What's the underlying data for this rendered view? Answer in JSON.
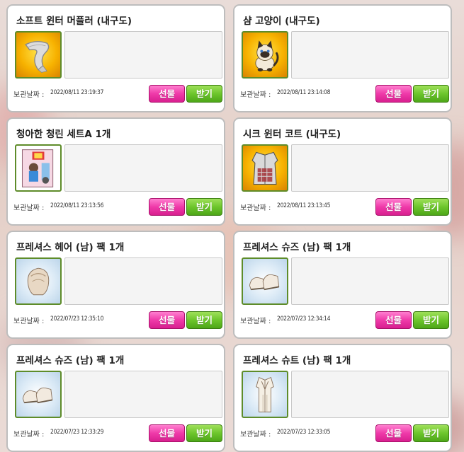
{
  "labels": {
    "gift": "선물",
    "receive": "받기",
    "stored_date": "보관날짜 :"
  },
  "items": [
    {
      "title": "소프트 윈터 머플러 (내구도)",
      "date": "2022/08/11 23:19:37",
      "icon": "muffler-icon"
    },
    {
      "title": "샴 고양이 (내구도)",
      "date": "2022/08/11 23:14:08",
      "icon": "siamese-cat-icon"
    },
    {
      "title": "청아한 청린 세트A 1개",
      "date": "2022/08/11 23:13:56",
      "icon": "set-box-icon"
    },
    {
      "title": "시크 윈터 코트 (내구도)",
      "date": "2022/08/11 23:13:45",
      "icon": "winter-coat-icon"
    },
    {
      "title": "프레셔스 헤어 (남) 팩 1개",
      "date": "2022/07/23 12:35:10",
      "icon": "hair-icon"
    },
    {
      "title": "프레셔스 슈즈 (남) 팩 1개",
      "date": "2022/07/23 12:34:14",
      "icon": "shoes-icon"
    },
    {
      "title": "프레셔스 슈즈 (남) 팩 1개",
      "date": "2022/07/23 12:33:29",
      "icon": "shoes-icon"
    },
    {
      "title": "프레셔스 슈트 (남) 팩 1개",
      "date": "2022/07/23 12:33:05",
      "icon": "suit-icon"
    }
  ],
  "colors": {
    "gift_button": "#ef3aa9",
    "receive_button": "#6dc62c",
    "icon_border": "#5e8c2a"
  }
}
